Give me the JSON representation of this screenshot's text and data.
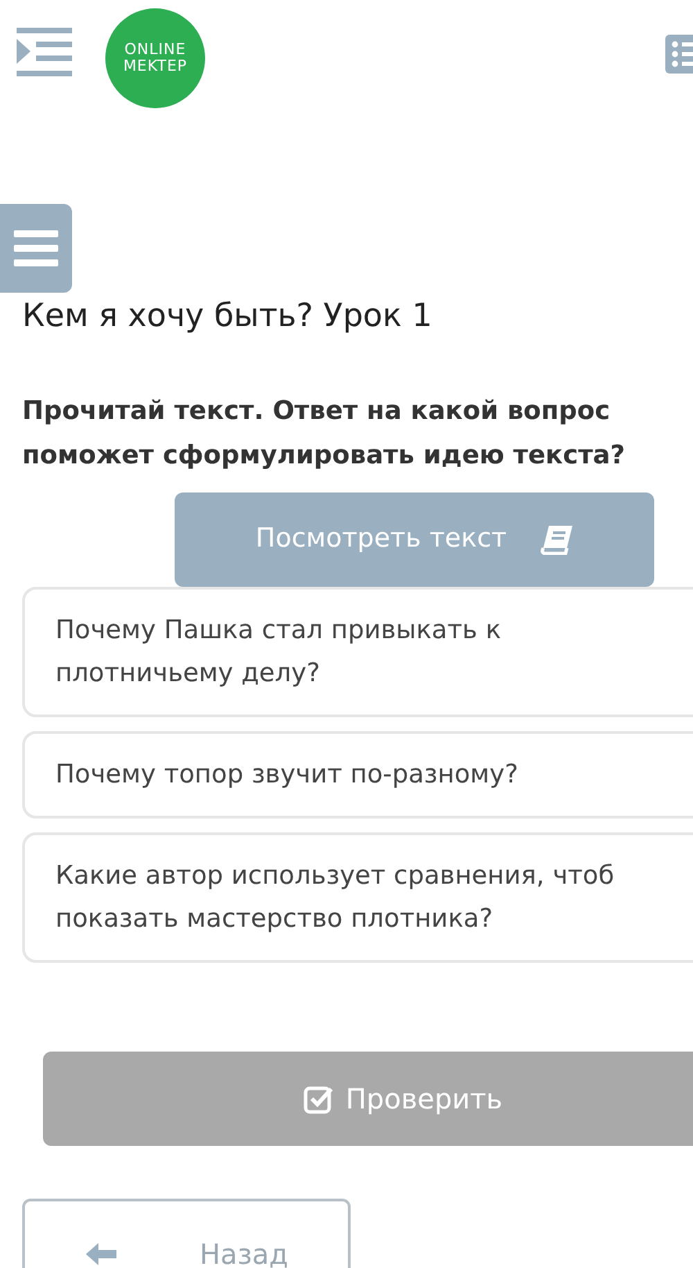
{
  "header": {
    "logo": [
      "ONLINE",
      "MEKTEP"
    ]
  },
  "lesson_title": "Кем я хочу быть? Урок 1",
  "question": "Прочитай текст. Ответ на какой вопрос поможет сформулировать идею текста?",
  "view_text_button": "Посмотреть текст",
  "options": [
    {
      "lines": [
        "Почему Пашка стал привыкать к",
        "плотничьему делу?"
      ],
      "selected": false
    },
    {
      "lines": [
        "Почему топор звучит по-разному?"
      ],
      "selected": false
    },
    {
      "lines": [
        "Какие автор использует сравнения, чтоб",
        "показать мастерство плотника?"
      ],
      "selected": false
    }
  ],
  "check_button": {
    "label": "Проверить",
    "disabled": true
  },
  "back_button": "Назад"
}
